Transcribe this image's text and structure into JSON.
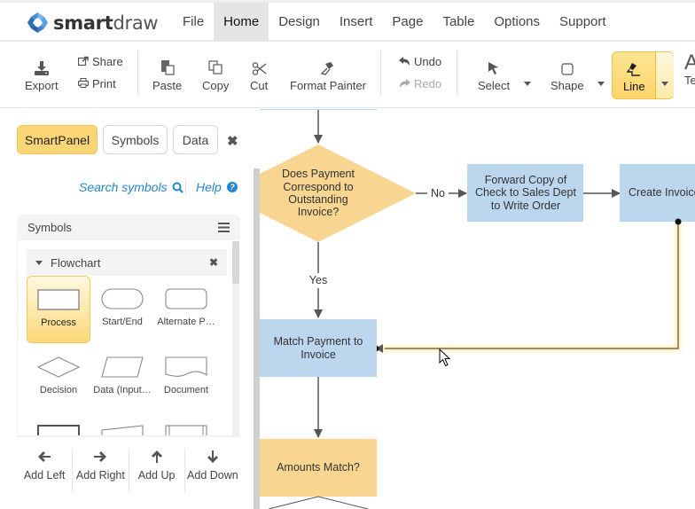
{
  "app": {
    "brand_light": "smart",
    "brand_bold": "draw"
  },
  "menu": {
    "items": [
      "File",
      "Home",
      "Design",
      "Insert",
      "Page",
      "Table",
      "Options",
      "Support"
    ],
    "active": "Home"
  },
  "ribbon": {
    "export": "Export",
    "share": "Share",
    "print": "Print",
    "paste": "Paste",
    "copy": "Copy",
    "cut": "Cut",
    "format_painter": "Format Painter",
    "undo": "Undo",
    "redo": "Redo",
    "select": "Select",
    "shape": "Shape",
    "line": "Line",
    "text_partial": "Te"
  },
  "panel": {
    "tabs": {
      "smartpanel": "SmartPanel",
      "symbols": "Symbols",
      "data": "Data"
    },
    "search_symbols": "Search symbols",
    "help": "Help",
    "symbols_header": "Symbols",
    "library": "Flowchart",
    "shapes": [
      {
        "label": "Process",
        "selected": true
      },
      {
        "label": "Start/End",
        "selected": false
      },
      {
        "label": "Alternate P…",
        "selected": false
      },
      {
        "label": "Decision",
        "selected": false
      },
      {
        "label": "Data (Input…",
        "selected": false
      },
      {
        "label": "Document",
        "selected": false
      }
    ],
    "add_buttons": {
      "left": "Add Left",
      "right": "Add Right",
      "up": "Add Up",
      "down": "Add Down"
    }
  },
  "diagram": {
    "colors": {
      "process": "#bcd6ee",
      "decision": "#f8d590",
      "connector": "#555555"
    },
    "nodes": {
      "decision1": "Does Payment Correspond to Outstanding Invoice?",
      "forward": "Forward Copy of Check to Sales Dept to Write Order",
      "create": "Create Invoice Order",
      "create_visible": "Create Invoic Order",
      "match": "Match Payment to Invoice",
      "amounts": "Amounts Match?"
    },
    "labels": {
      "no": "No",
      "yes": "Yes"
    }
  }
}
